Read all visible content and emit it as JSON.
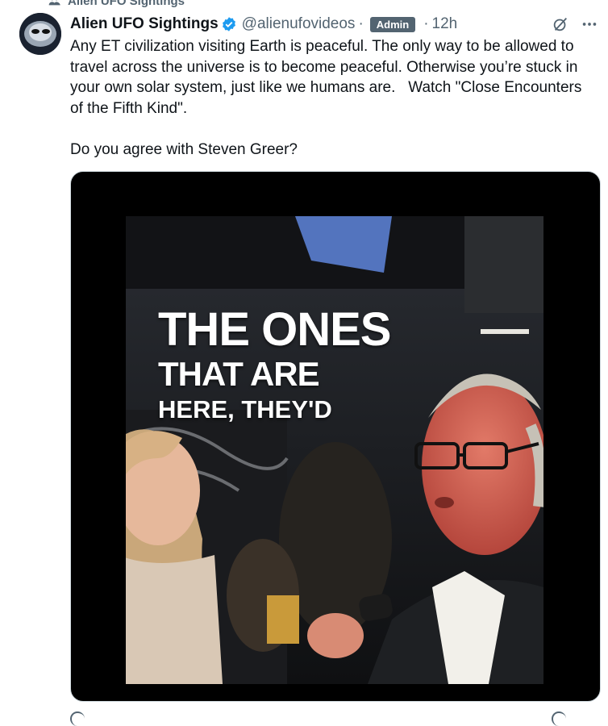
{
  "context": {
    "label": "Alien UFO Sightings"
  },
  "tweet": {
    "author_name": "Alien UFO Sightings",
    "handle": "@alienufovideos",
    "separator": "·",
    "badge": "Admin",
    "time": "12h",
    "text": "Any ET civilization visiting Earth is peaceful. The only way to be allowed to travel across the universe is to become peaceful. Otherwise you’re stuck in your own solar system, just like we humans are.   Watch \"Close Encounters of the Fifth Kind\".\n\nDo you agree with Steven Greer?"
  },
  "video": {
    "caption_line1": "THE ONES",
    "caption_line2": "THAT ARE",
    "caption_line3": "HERE, THEY'D"
  },
  "colors": {
    "verified": "#1d9bf0",
    "muted": "#536471",
    "text": "#0f1419",
    "badge_bg": "#536471"
  },
  "icons": {
    "context": "community-icon",
    "verified": "verified-badge-icon",
    "grok": "grok-icon",
    "more": "more-icon"
  }
}
